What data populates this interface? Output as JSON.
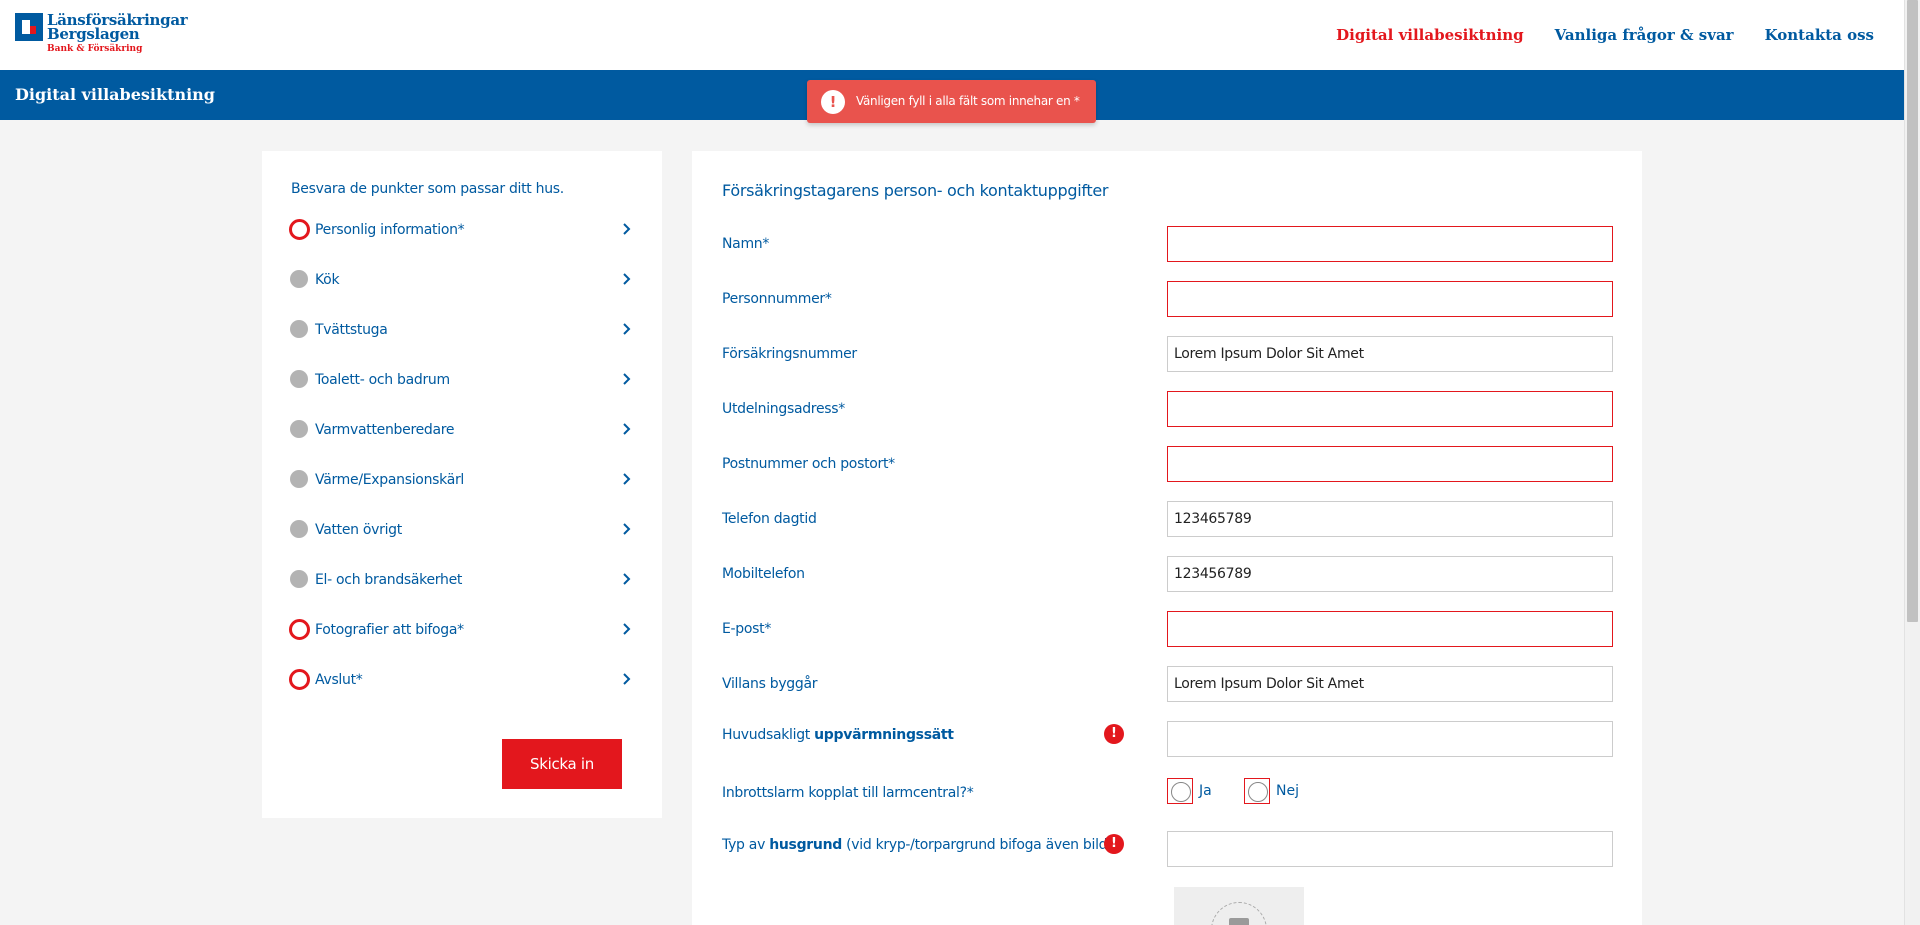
{
  "logo": {
    "line1": "Länsförsäkringar",
    "line2": "Bergslagen",
    "line3": "Bank & Försäkring"
  },
  "nav": {
    "items": [
      {
        "label": "Digital villabesiktning",
        "active": true
      },
      {
        "label": "Vanliga frågor & svar",
        "active": false
      },
      {
        "label": "Kontakta oss",
        "active": false
      }
    ]
  },
  "banner": {
    "title": "Digital villabesiktning"
  },
  "toast": {
    "icon": "exclamation-icon",
    "message": "Vänligen fyll i alla fält som innehar en *"
  },
  "sidebar": {
    "heading": "Besvara de punkter som passar ditt hus.",
    "steps": [
      {
        "label": "Personlig information*",
        "status": "required"
      },
      {
        "label": "Kök",
        "status": "neutral"
      },
      {
        "label": "Tvättstuga",
        "status": "neutral"
      },
      {
        "label": "Toalett- och badrum",
        "status": "neutral"
      },
      {
        "label": "Varmvattenberedare",
        "status": "neutral"
      },
      {
        "label": "Värme/Expansionskärl",
        "status": "neutral"
      },
      {
        "label": "Vatten övrigt",
        "status": "neutral"
      },
      {
        "label": "El- och brandsäkerhet",
        "status": "neutral"
      },
      {
        "label": "Fotografier att bifoga*",
        "status": "required"
      },
      {
        "label": "Avslut*",
        "status": "required"
      }
    ],
    "submit_label": "Skicka in"
  },
  "form": {
    "heading": "Försäkringstagarens person- och kontaktuppgifter",
    "fields": {
      "namn": {
        "label": "Namn*",
        "value": ""
      },
      "personnummer": {
        "label": "Personnummer*",
        "value": ""
      },
      "forsakringsnummer": {
        "label": "Försäkringsnummer",
        "value": "Lorem Ipsum Dolor Sit Amet"
      },
      "adress": {
        "label": "Utdelningsadress*",
        "value": ""
      },
      "postnummer": {
        "label": "Postnummer och postort*",
        "value": ""
      },
      "telefon": {
        "label": "Telefon dagtid",
        "value": "123465789"
      },
      "mobil": {
        "label": "Mobiltelefon",
        "value": "123456789"
      },
      "epost": {
        "label": "E-post*",
        "value": ""
      },
      "byggar": {
        "label": "Villans byggår",
        "value": "Lorem Ipsum Dolor Sit Amet"
      },
      "uppvarmning": {
        "label_pre": "Huvudsakligt ",
        "label_bold": "uppvärmningssätt",
        "value": ""
      },
      "husgrund": {
        "label_pre": "Typ av ",
        "label_bold": "husgrund",
        "label_post": " (vid kryp-/torpargrund bifoga även bild)",
        "value": ""
      }
    },
    "larm": {
      "label": "Inbrottslarm kopplat till larmcentral?*",
      "yes": "Ja",
      "no": "Nej"
    }
  },
  "colors": {
    "brand_blue": "#005aa0",
    "brand_red": "#e3171d",
    "toast_red": "#e9534d"
  }
}
